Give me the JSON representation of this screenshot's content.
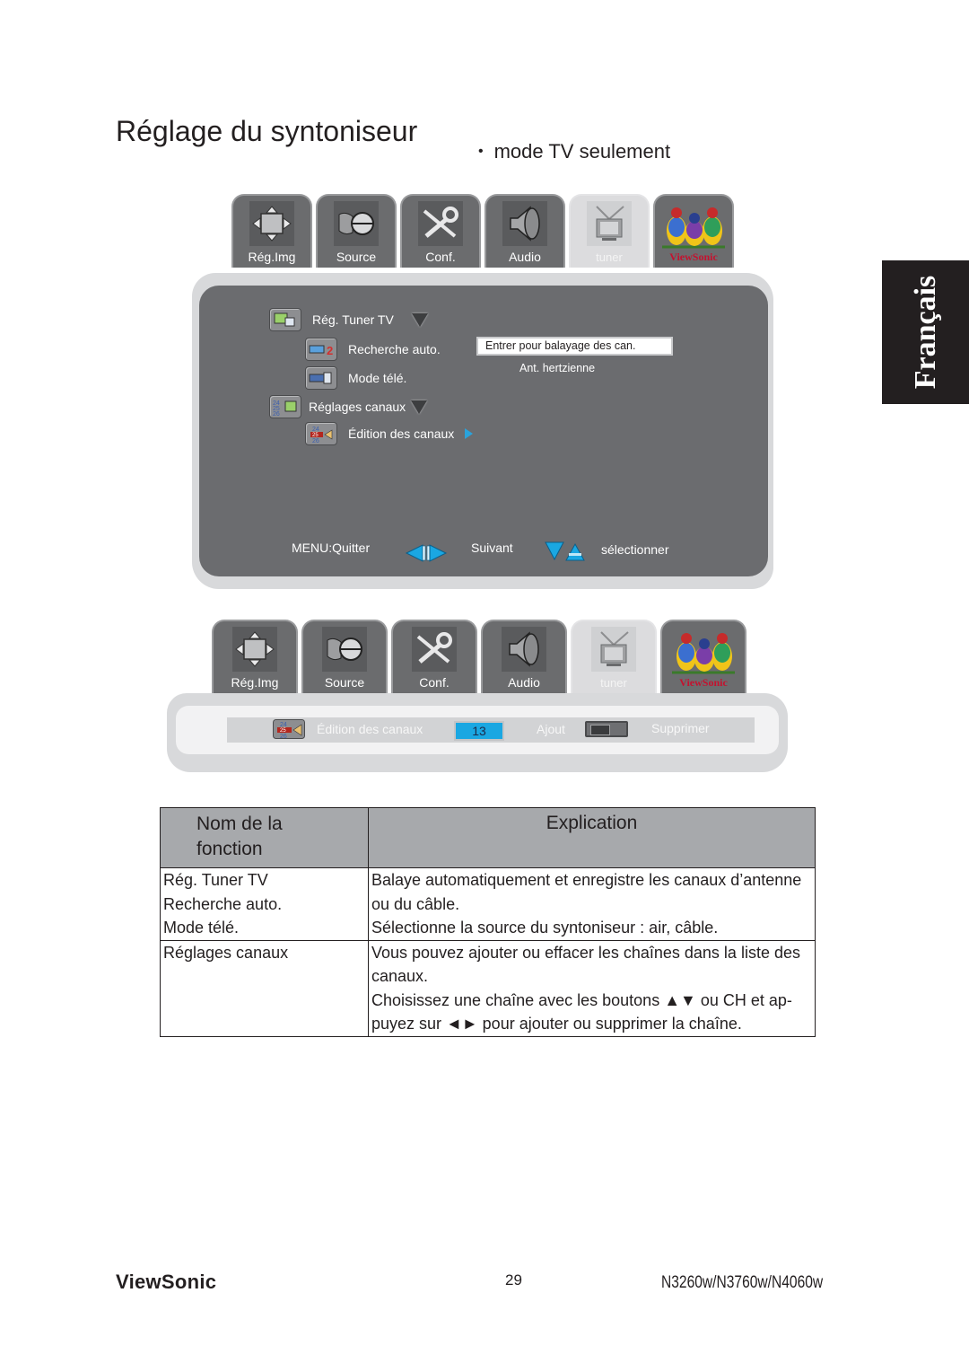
{
  "page": {
    "title": "Réglage du syntoniseur",
    "subtitle": "mode TV seulement",
    "language_tab": "Français"
  },
  "osd_tabs": [
    {
      "label": "Rég.Img",
      "icon": "move-arrows-icon",
      "active": false
    },
    {
      "label": "Source",
      "icon": "connector-icon",
      "active": false
    },
    {
      "label": "Conf.",
      "icon": "tools-icon",
      "active": false
    },
    {
      "label": "Audio",
      "icon": "speaker-icon",
      "active": false
    },
    {
      "label": "tuner",
      "icon": "tv-antenna-icon",
      "active": true
    },
    {
      "label": "ViewSonic",
      "icon": "viewsonic-birds-logo",
      "active": false
    }
  ],
  "osd_menu": {
    "items": [
      {
        "label": "Rég. Tuner TV",
        "icon": "tuner-settings-icon",
        "indicator": "expanded"
      },
      {
        "label": "Recherche auto.",
        "icon": "auto-search-icon"
      },
      {
        "label": "Mode télé.",
        "icon": "tv-mode-icon"
      },
      {
        "label": "Réglages canaux",
        "icon": "channel-settings-icon",
        "indicator": "expanded"
      },
      {
        "label": "Édition des canaux",
        "icon": "channel-edit-icon",
        "indicator": "submenu"
      }
    ],
    "hint_box": "Entrer pour balayage des can.",
    "hint_sub": "Ant. hertzienne",
    "footer": {
      "menu_quit": "MENU:Quitter",
      "next": "Suivant",
      "select": "sélectionner"
    }
  },
  "channel_edit_bar": {
    "label": "Édition des canaux",
    "channel_number": "13",
    "add_label": "Ajout",
    "delete_label": "Supprimer"
  },
  "table": {
    "headers": [
      "Nom de la fonction",
      "Explication"
    ],
    "header_lines": [
      "Nom de la",
      "fonction"
    ],
    "rows": [
      {
        "name": "Rég. Tuner TV",
        "explanation": "Balaye automatiquement et enregistre les canaux d’antenne"
      },
      {
        "name": "Recherche auto.",
        "explanation": "ou du câble."
      },
      {
        "name": "Mode télé.",
        "explanation": "Sélectionne la source du syntoniseur : air, câble."
      },
      {
        "name": "Réglages canaux",
        "explanation": "Vous pouvez ajouter ou effacer les chaînes dans la liste des"
      },
      {
        "name": "",
        "explanation": "canaux."
      },
      {
        "name": "",
        "explanation": "Choisissez une chaîne avec les boutons ▲▼ ou CH et ap-"
      },
      {
        "name": "",
        "explanation": "puyez sur ◄► pour ajouter ou supprimer la chaîne."
      }
    ]
  },
  "footer": {
    "brand": "ViewSonic",
    "page_number": "29",
    "models": "N3260w/N3760w/N4060w"
  },
  "colors": {
    "osd_panel": "#6b6c6f",
    "osd_frame": "#d8d9db",
    "accent_blue": "#1aa7e2",
    "table_header": "#a7a9ac",
    "brand_red": "#c4122f"
  }
}
